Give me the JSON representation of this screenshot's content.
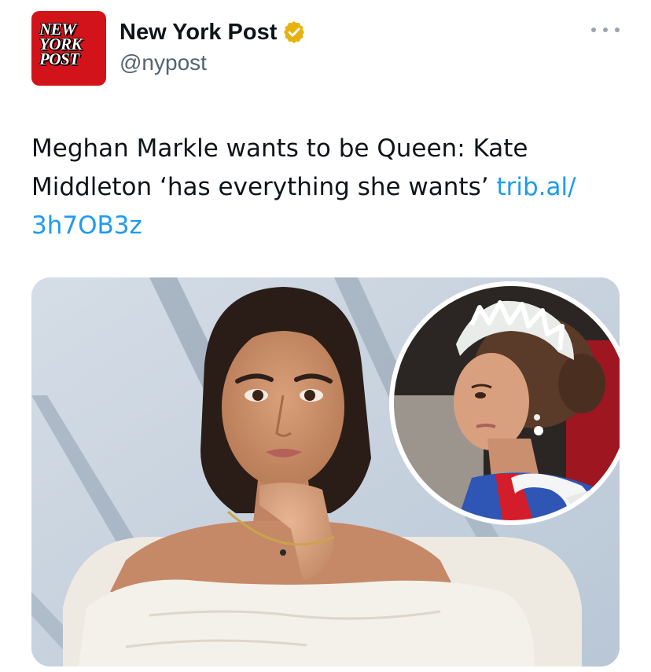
{
  "account": {
    "display_name": "New York Post",
    "handle": "@nypost",
    "verified": true,
    "avatar_icon": "new-york-post-logo",
    "avatar_lines": [
      "NEW",
      "YORK",
      "POST"
    ],
    "brand_color": "#d3131a",
    "verified_badge_color": "#e8b20e"
  },
  "tweet": {
    "text_part1": "Meghan Markle wants to be Queen: Kate Middleton ‘has everything she wants’ ",
    "link_part1": "trib.al/",
    "link_part2": "3h7OB3z",
    "link_color": "#1d9bf0"
  },
  "media": {
    "description_icon": "photo-composite",
    "inset_icon": "circular-inset-photo"
  },
  "menu": {
    "icon": "more-icon"
  }
}
